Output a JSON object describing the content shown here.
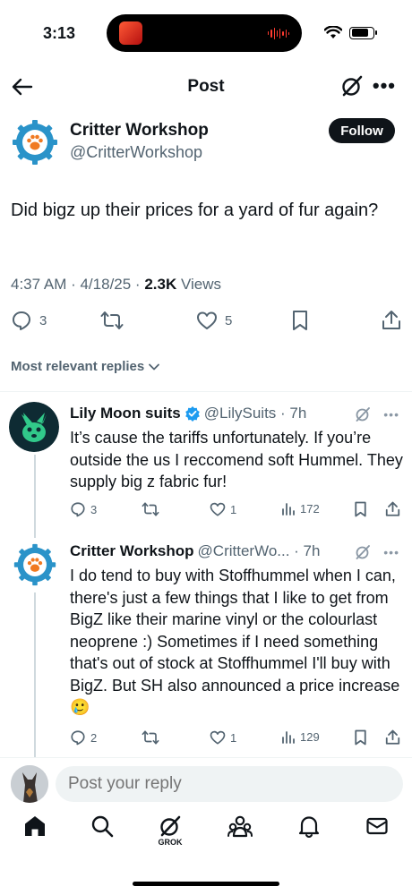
{
  "status_bar": {
    "time": "3:13"
  },
  "header": {
    "title": "Post"
  },
  "post": {
    "author_name": "Critter Workshop",
    "author_handle": "@CritterWorkshop",
    "follow_label": "Follow",
    "text": "Did bigz up their prices for a yard of fur again?",
    "timestamp": "4:37 AM · 4/18/25 · ",
    "views_count": "2.3K",
    "views_label": " Views",
    "replies": "3",
    "likes": "5"
  },
  "sort_label": "Most relevant replies",
  "replies": [
    {
      "name": "Lily Moon suits",
      "handle": "@LilySuits · 7h",
      "text": "It’s cause the tariffs unfortunately. If you’re outside the us I reccomend soft Hummel. They supply big z fabric fur!",
      "replies": "3",
      "reposts": "",
      "likes": "1",
      "views": "172"
    },
    {
      "name": "Critter Workshop",
      "handle": "@CritterWo... · 7h",
      "text": "I do tend to buy with Stoffhummel when I can, there's just a few things that I like to get from BigZ like their marine vinyl or the colourlast neoprene :) Sometimes if I need something that's out of stock at Stoffhummel I'll buy with BigZ. But SH also announced a price increase🥲",
      "replies": "2",
      "reposts": "",
      "likes": "1",
      "views": "129"
    }
  ],
  "composer": {
    "placeholder": "Post your reply"
  },
  "tabbar": {
    "grok_label": "GROK"
  },
  "colors": {
    "accent": "#1d9bf0",
    "text": "#0f1419",
    "muted": "#536471",
    "gear_blue": "#2a93c9",
    "paw_orange": "#f07a22",
    "lily_green": "#31c98a"
  }
}
